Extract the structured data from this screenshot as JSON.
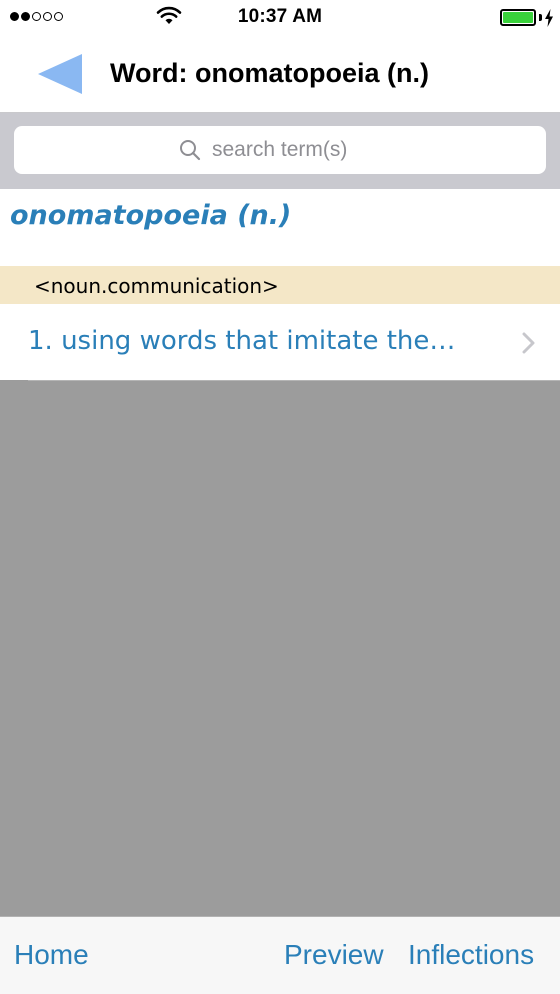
{
  "status_bar": {
    "signal_filled": 2,
    "signal_total": 5,
    "time": "10:37 AM",
    "battery_color": "#39d23b"
  },
  "nav": {
    "title": "Word: onomatopoeia (n.)",
    "back_icon": "back-arrow-icon",
    "back_color": "#8ab8f2"
  },
  "search": {
    "placeholder": "search term(s)",
    "value": ""
  },
  "entry": {
    "headword": "onomatopoeia (n.)",
    "category": "<noun.communication>",
    "senses": [
      {
        "label": "1. using words that imitate the…"
      }
    ]
  },
  "toolbar": {
    "home_label": "Home",
    "preview_label": "Preview",
    "inflections_label": "Inflections"
  },
  "colors": {
    "accent": "#2a7fb8",
    "category_band": "#f4e7c7",
    "empty_area": "#9c9c9c"
  }
}
